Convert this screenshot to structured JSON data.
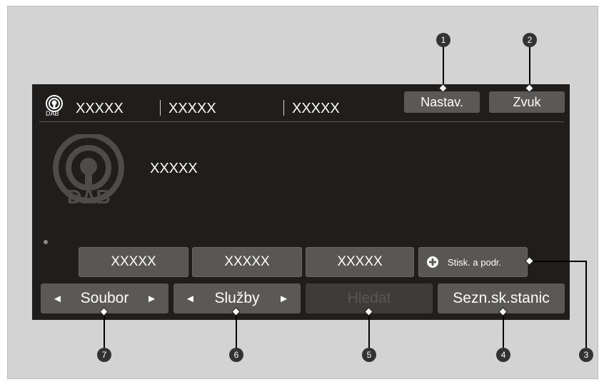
{
  "topbar": {
    "field1": "XXXXX",
    "field2": "XXXXX",
    "field3": "XXXXX",
    "settings_label": "Nastav.",
    "sound_label": "Zvuk",
    "dab_badge": "DAB"
  },
  "station": {
    "logo_text": "DAB",
    "name": "XXXXX"
  },
  "presets": [
    {
      "label": "XXXXX"
    },
    {
      "label": "XXXXX"
    },
    {
      "label": "XXXXX"
    },
    {
      "label": "Stisk. a podr."
    }
  ],
  "bottom_buttons": [
    {
      "label": "Soubor",
      "left_arrow": "◄",
      "right_arrow": "►"
    },
    {
      "label": "Služby",
      "left_arrow": "◄",
      "right_arrow": "►"
    },
    {
      "label": "Hledat"
    },
    {
      "label": "Sezn.sk.stanic"
    }
  ],
  "callouts": [
    "1",
    "2",
    "3",
    "4",
    "5",
    "6",
    "7"
  ]
}
